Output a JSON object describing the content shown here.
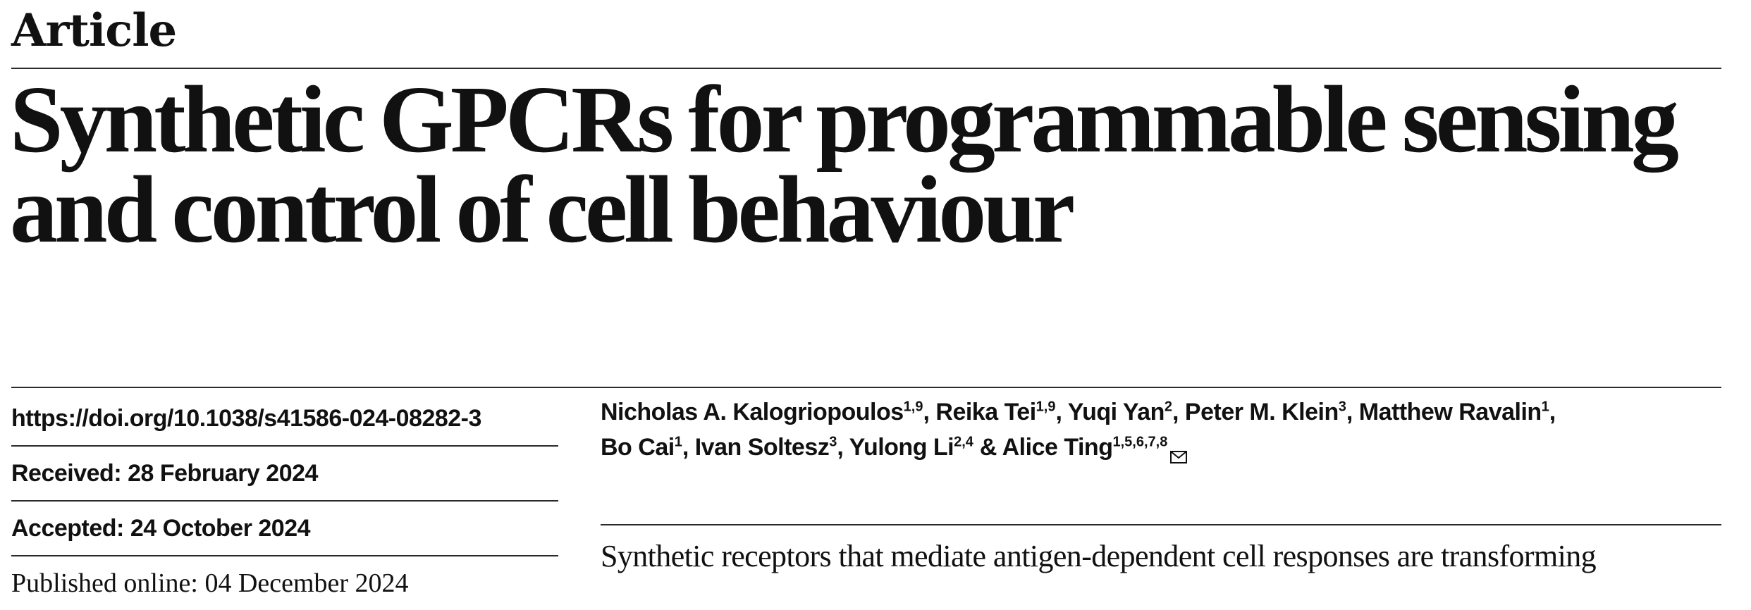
{
  "header": {
    "label": "Article",
    "title_line1": "Synthetic GPCRs for programmable sensing",
    "title_line2": "and control of cell behaviour"
  },
  "meta": {
    "doi": "https://doi.org/10.1038/s41586-024-08282-3",
    "received": "Received: 28 February 2024",
    "accepted": "Accepted: 24 October 2024",
    "published": "Published online: 04 December 2024"
  },
  "authors": [
    {
      "name": "Nicholas A. Kalogriopoulos",
      "aff": "1,9",
      "sep": ", "
    },
    {
      "name": "Reika Tei",
      "aff": "1,9",
      "sep": ", "
    },
    {
      "name": "Yuqi Yan",
      "aff": "2",
      "sep": ", "
    },
    {
      "name": "Peter M. Klein",
      "aff": "3",
      "sep": ", "
    },
    {
      "name": "Matthew Ravalin",
      "aff": "1",
      "sep": ","
    },
    {
      "name": "Bo Cai",
      "aff": "1",
      "sep": ", "
    },
    {
      "name": "Ivan Soltesz",
      "aff": "3",
      "sep": ", "
    },
    {
      "name": "Yulong Li",
      "aff": "2,4",
      "sep": " & "
    },
    {
      "name": "Alice Ting",
      "aff": "1,5,6,7,8",
      "sep": ""
    }
  ],
  "corresponding_icon": "envelope-icon",
  "abstract": {
    "line1": "Synthetic receptors that mediate antigen-dependent cell responses are transforming"
  }
}
